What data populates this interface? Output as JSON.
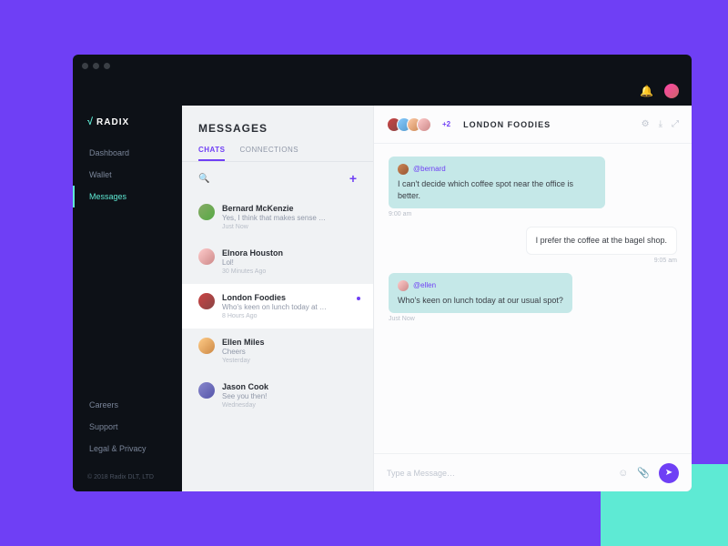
{
  "brand": {
    "mark": "√",
    "name": "RADIX"
  },
  "nav": {
    "main": [
      {
        "label": "Dashboard"
      },
      {
        "label": "Wallet"
      },
      {
        "label": "Messages"
      }
    ],
    "bottom": [
      {
        "label": "Careers"
      },
      {
        "label": "Support"
      },
      {
        "label": "Legal & Privacy"
      }
    ]
  },
  "copyright": "© 2018 Radix DLT, LTD",
  "messages": {
    "title": "MESSAGES",
    "tabs": [
      "CHATS",
      "CONNECTIONS"
    ],
    "chats": [
      {
        "name": "Bernard McKenzie",
        "preview": "Yes, I think that makes sense …",
        "time": "Just Now"
      },
      {
        "name": "Elnora Houston",
        "preview": "Lol!",
        "time": "30 Minutes Ago"
      },
      {
        "name": "London Foodies",
        "preview": "Who's keen on lunch today at …",
        "time": "8 Hours Ago"
      },
      {
        "name": "Ellen Miles",
        "preview": "Cheers",
        "time": "Yesterday"
      },
      {
        "name": "Jason Cook",
        "preview": "See you then!",
        "time": "Wednesday"
      }
    ]
  },
  "conversation": {
    "extra": "+2",
    "title": "LONDON FOODIES",
    "thread": [
      {
        "user": "@bernard",
        "text": "I can't decide which coffee spot near the office is better.",
        "time": "9:00 am",
        "type": "received"
      },
      {
        "text": "I prefer the coffee at the bagel shop.",
        "time": "9:05 am",
        "type": "sent"
      },
      {
        "user": "@ellen",
        "text": "Who's keen on lunch today at our usual spot?",
        "time": "Just Now",
        "type": "received"
      }
    ],
    "composer_placeholder": "Type a Message…"
  }
}
